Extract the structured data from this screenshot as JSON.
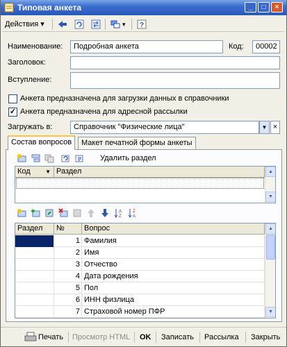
{
  "window": {
    "title": "Типовая анкета"
  },
  "toolbar": {
    "actions_label": "Действия"
  },
  "form": {
    "name_label": "Наименование:",
    "name_value": "Подробная анкета",
    "code_label": "Код:",
    "code_value": "00002",
    "header_label": "Заголовок:",
    "header_value": "",
    "intro_label": "Вступление:",
    "intro_value": "",
    "chk1_label": "Анкета предназначена для загрузки данных в справочники",
    "chk1_checked": false,
    "chk2_label": "Анкета предназначена для адресной рассылки",
    "chk2_checked": true,
    "load_label": "Загружать в:",
    "load_value": "Справочник \"Физические лица\""
  },
  "tabs": [
    {
      "label": "Состав вопросов",
      "active": true
    },
    {
      "label": "Макет печатной формы анкеты",
      "active": false
    }
  ],
  "sections": {
    "delete_label": "Удалить раздел",
    "columns": [
      "Код",
      "Раздел"
    ]
  },
  "questions": {
    "columns": [
      "Раздел",
      "№",
      "Вопрос"
    ],
    "rows": [
      {
        "n": "1",
        "q": "Фамилия"
      },
      {
        "n": "2",
        "q": "Имя"
      },
      {
        "n": "3",
        "q": "Отчество"
      },
      {
        "n": "4",
        "q": "Дата рождения"
      },
      {
        "n": "5",
        "q": "Пол"
      },
      {
        "n": "6",
        "q": "ИНН физлица"
      },
      {
        "n": "7",
        "q": "Страховой номер ПФР"
      }
    ]
  },
  "bottom": {
    "print": "Печать",
    "preview": "Просмотр HTML",
    "ok": "OK",
    "save": "Записать",
    "mailing": "Рассылка",
    "close": "Закрыть"
  }
}
